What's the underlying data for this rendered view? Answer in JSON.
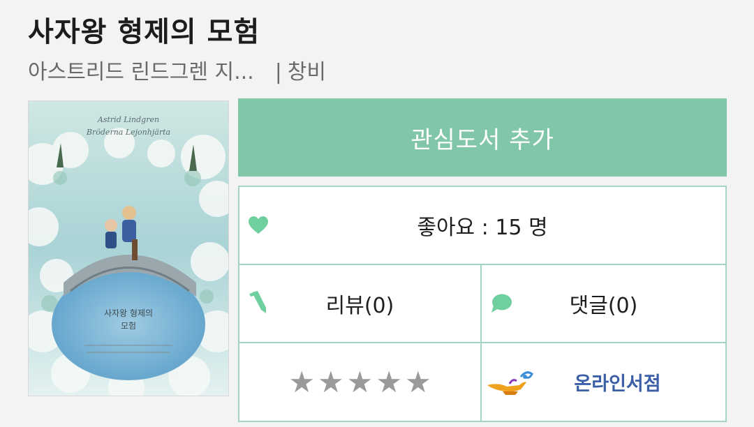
{
  "book": {
    "title": "사자왕 형제의 모험",
    "author": "아스트리드 린드그렌 지...",
    "separator": "|",
    "publisher": "창비"
  },
  "actions": {
    "add_to_wishlist": "관심도서 추가"
  },
  "stats": {
    "likes_label": "좋아요 : 15 명",
    "reviews_label": "리뷰(0)",
    "comments_label": "댓글(0)",
    "rating": 0,
    "rating_max": 5,
    "online_store_label": "온라인서점"
  },
  "icons": {
    "like": "heart-icon",
    "review": "pencil-icon",
    "comment": "speech-bubble-icon",
    "store": "magic-lamp-icon"
  },
  "colors": {
    "accent": "#82c6a9",
    "border": "#a5d5c0",
    "icon": "#6fcf9f",
    "store_link": "#3a5fa6",
    "star_empty": "#9a9a9a"
  }
}
